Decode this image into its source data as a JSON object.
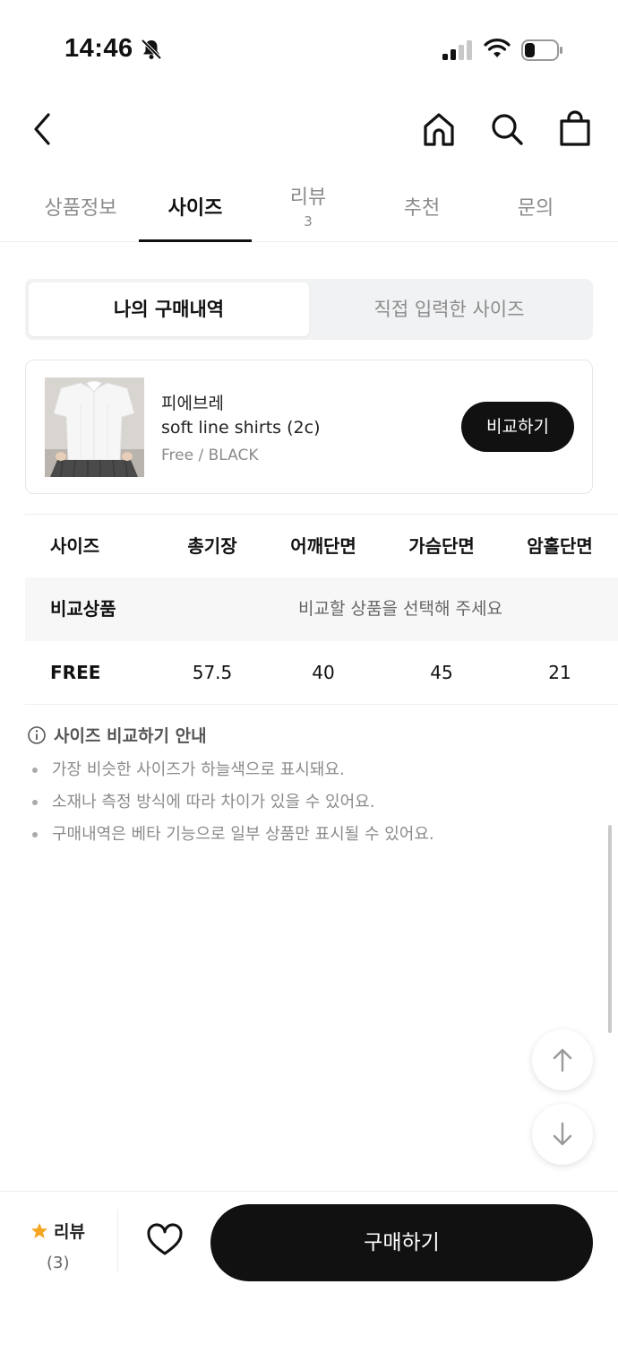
{
  "status_bar": {
    "time": "14:46"
  },
  "tabs": [
    {
      "label": "상품정보",
      "count": ""
    },
    {
      "label": "사이즈",
      "count": ""
    },
    {
      "label": "리뷰",
      "count": "3"
    },
    {
      "label": "추천",
      "count": ""
    },
    {
      "label": "문의",
      "count": ""
    }
  ],
  "active_tab": "사이즈",
  "segmented": {
    "selected": "나의 구매내역",
    "other": "직접 입력한 사이즈"
  },
  "product": {
    "brand": "피에브레",
    "name": "soft line shirts (2c)",
    "option": "Free / BLACK",
    "compare_label": "비교하기"
  },
  "size_table": {
    "headers": [
      "사이즈",
      "총기장",
      "어깨단면",
      "가슴단면",
      "암홀단면"
    ],
    "compare_row": {
      "label": "비교상품",
      "placeholder": "비교할 상품을 선택해 주세요"
    },
    "rows": [
      {
        "size": "FREE",
        "values": [
          "57.5",
          "40",
          "45",
          "21"
        ]
      }
    ]
  },
  "guide": {
    "title": "사이즈 비교하기 안내",
    "items": [
      "가장 비슷한 사이즈가 하늘색으로 표시돼요.",
      "소재나 측정 방식에 따라 차이가 있을 수 있어요.",
      "구매내역은 베타 기능으로 일부 상품만 표시될 수 있어요."
    ]
  },
  "bottom_bar": {
    "review_label": "리뷰",
    "review_count": "(3)",
    "buy_label": "구매하기",
    "star_color": "#f5a623"
  },
  "icons": [
    "bell-slash-icon",
    "signal-icon",
    "wifi-icon",
    "battery-icon",
    "back-icon",
    "home-icon",
    "search-icon",
    "bag-icon",
    "info-icon",
    "arrow-up-icon",
    "arrow-down-icon",
    "star-icon",
    "heart-icon"
  ]
}
